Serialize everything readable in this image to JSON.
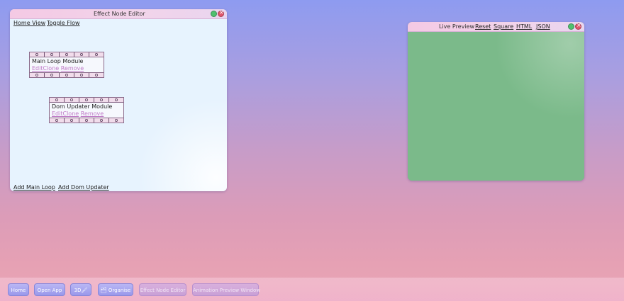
{
  "editor": {
    "title": "Effect Node Editor",
    "menu": {
      "home_view": "Home View",
      "toggle_flow": "Toggle Flow"
    },
    "nodes": [
      {
        "name": "Main Loop Module",
        "actions": [
          "Edit",
          "Clone",
          "Remove"
        ]
      },
      {
        "name": "Dom Updater Module",
        "actions": [
          "Edit",
          "Clone",
          "Remove"
        ]
      }
    ],
    "footer": {
      "add_main_loop": "Add Main Loop",
      "add_dom_updater": "Add Dom Updater"
    }
  },
  "preview": {
    "title": "Live Preview",
    "links": {
      "reset": "Reset",
      "square": "Square",
      "html": "HTML",
      "json": "JSON"
    },
    "stage_color": "#7bba8a"
  },
  "taskbar": {
    "items": [
      "Home",
      "Open App",
      "3D🖌",
      "🗂 Organise",
      "Effect Node Editor",
      "Animation Preview Window"
    ]
  },
  "colors": {
    "accent": "#9a98ea",
    "editor_bg": "#e7f3fe",
    "node_link": "#c07bc8"
  }
}
